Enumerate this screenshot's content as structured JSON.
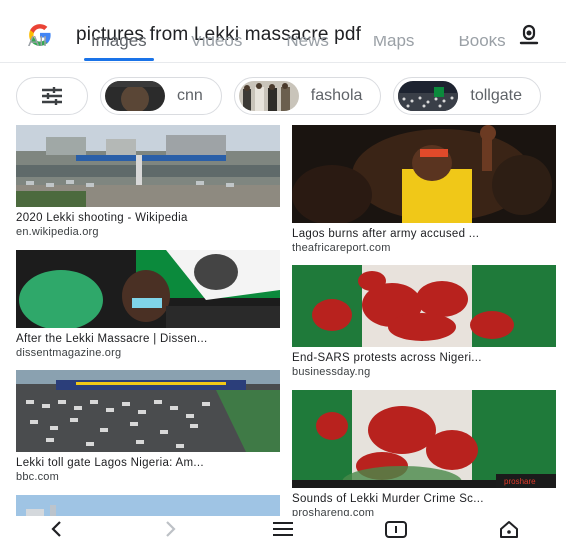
{
  "search": {
    "query": "pictures from Lekki massacre pdf"
  },
  "tabs": [
    "All",
    "Images",
    "Videos",
    "News",
    "Maps",
    "Books"
  ],
  "chips": [
    {
      "label": "cnn"
    },
    {
      "label": "fashola"
    },
    {
      "label": "tollgate"
    }
  ],
  "results": [
    {
      "title": "2020 Lekki shooting - Wikipedia",
      "source": "en.wikipedia.org"
    },
    {
      "title": "Lagos burns after army accused ...",
      "source": "theafricareport.com"
    },
    {
      "title": "After the Lekki Massacre | Dissen...",
      "source": "dissentmagazine.org"
    },
    {
      "title": "End-SARS protests across Nigeri...",
      "source": "businessday.ng"
    },
    {
      "title": "Lekki toll gate Lagos Nigeria: Am...",
      "source": "bbc.com"
    },
    {
      "title": "Sounds of Lekki Murder Crime Sc...",
      "source": "proshareng.com"
    }
  ],
  "colors": {
    "accent": "#1a73e8",
    "nigeria_green": "#0b8a3c"
  }
}
